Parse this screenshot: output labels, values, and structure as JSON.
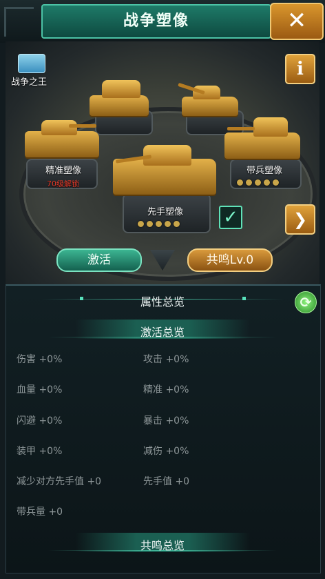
{
  "header": {
    "title": "战争塑像",
    "close_icon": "✕"
  },
  "scene": {
    "king_label": "战争之王",
    "info_icon": "i",
    "next_icon": "❯",
    "statues": [
      {
        "name": "精准塑像",
        "lock_text": "70级解锁"
      },
      {
        "name": "先手塑像",
        "checked": true
      },
      {
        "name": "带兵塑像"
      }
    ]
  },
  "buttons": {
    "activate": "激活",
    "resonance": "共鸣Lv.0"
  },
  "panel": {
    "overview_title": "属性总览",
    "activation_title": "激活总览",
    "resonance_title": "共鸣总览",
    "attributes": [
      {
        "label": "伤害",
        "value": "+0%"
      },
      {
        "label": "攻击",
        "value": "+0%"
      },
      {
        "label": "血量",
        "value": "+0%"
      },
      {
        "label": "精准",
        "value": "+0%"
      },
      {
        "label": "闪避",
        "value": "+0%"
      },
      {
        "label": "暴击",
        "value": "+0%"
      },
      {
        "label": "装甲",
        "value": "+0%"
      },
      {
        "label": "减伤",
        "value": "+0%"
      },
      {
        "label": "减少对方先手值",
        "value": "+0"
      },
      {
        "label": "先手值",
        "value": "+0"
      },
      {
        "label": "带兵量",
        "value": "+0"
      }
    ]
  },
  "colors": {
    "accent": "#4cc3a6",
    "gold": "#d99a3c",
    "lock": "#e23a2a"
  }
}
